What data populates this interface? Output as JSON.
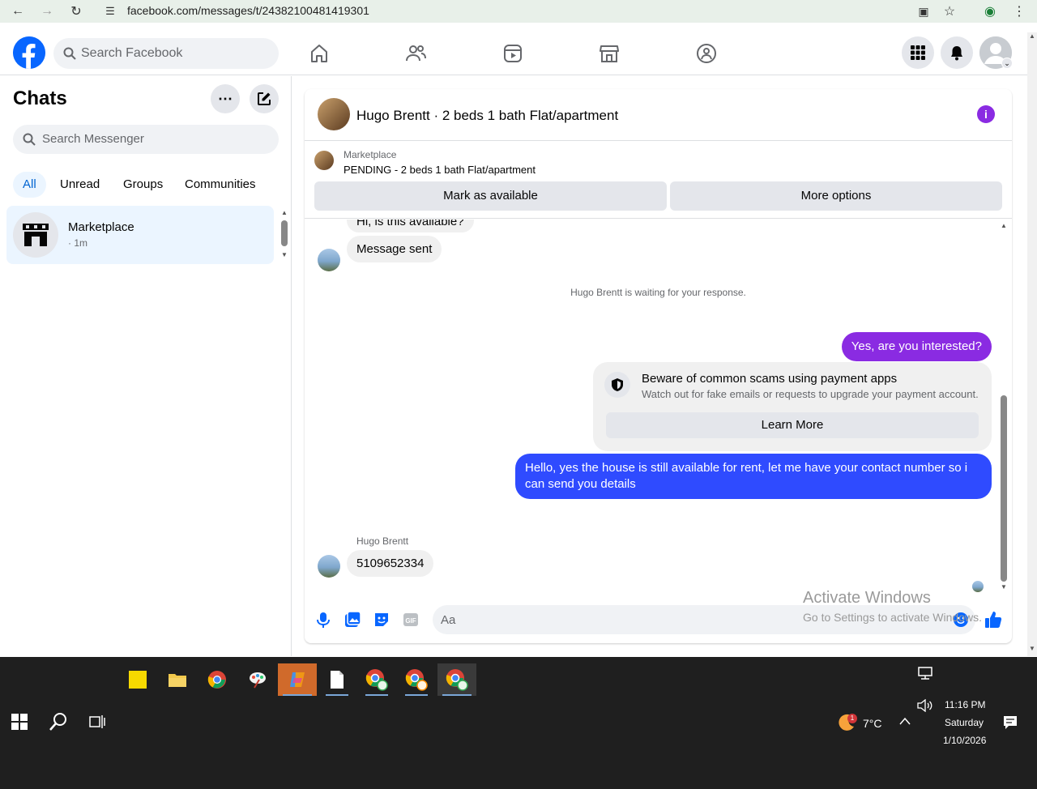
{
  "browser": {
    "url": "facebook.com/messages/t/24382100481419301"
  },
  "header": {
    "search_placeholder": "Search Facebook"
  },
  "sidebar": {
    "title": "Chats",
    "search_placeholder": "Search Messenger",
    "filters": [
      "All",
      "Unread",
      "Groups",
      "Communities"
    ],
    "active_filter": "All",
    "chats": [
      {
        "name": "Marketplace",
        "time": "· 1m"
      }
    ]
  },
  "conversation": {
    "title": "Hugo Brentt · 2 beds 1 bath Flat/apartment",
    "listing": {
      "source": "Marketplace",
      "status": "PENDING - 2 beds 1 bath Flat/apartment",
      "mark_available_label": "Mark as available",
      "more_options_label": "More options"
    },
    "messages": {
      "partial_top": "Hi, is this available?",
      "auto_reply": "Message sent",
      "waiting_notice": "Hugo Brentt is waiting for your response.",
      "outgoing_1": "Yes, are you interested?",
      "scam_title": "Beware of common scams using payment apps",
      "scam_subtitle": "Watch out for fake emails or requests to upgrade your payment account.",
      "learn_more_label": "Learn More",
      "outgoing_2": "Hello, yes the house is still available for rent, let me have your contact number so i can send you details",
      "sender_name": "Hugo Brentt",
      "incoming_number": "5109652334"
    },
    "composer_placeholder": "Aa"
  },
  "watermark": {
    "line1": "Activate Windows",
    "line2": "Go to Settings to activate Windows."
  },
  "taskbar": {
    "temperature": "7°C",
    "weather_badge": "1",
    "time": "11:16 PM",
    "day": "Saturday",
    "date": "1/10/2026"
  },
  "colors": {
    "fb_blue": "#0866ff",
    "bubble_purple": "#8a2be2",
    "bubble_blue": "#2f4bff",
    "active_chat_bg": "#ebf5ff"
  }
}
